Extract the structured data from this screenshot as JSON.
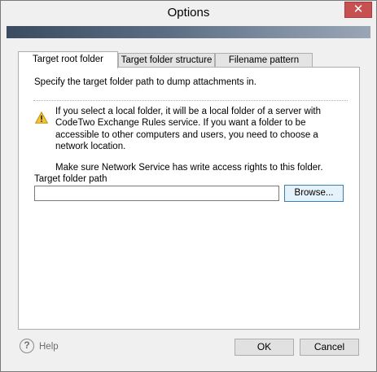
{
  "window": {
    "title": "Options",
    "close_glyph": "✕"
  },
  "tabs": [
    {
      "label": "Target root folder",
      "active": true
    },
    {
      "label": "Target folder structure",
      "active": false
    },
    {
      "label": "Filename pattern",
      "active": false
    }
  ],
  "panel": {
    "description": "Specify the target folder path to dump attachments in.",
    "warning_icon": "warning-triangle-icon",
    "warning_paragraph_1": "If you select a local folder, it will be a local folder of a server with CodeTwo Exchange Rules service. If you want a folder to be accessible to other computers and users, you need to choose a network location.",
    "warning_paragraph_2": "Make sure Network Service has write access rights to this folder.",
    "field_label": "Target folder path",
    "field_value": "",
    "browse_label": "Browse..."
  },
  "footer": {
    "help_glyph": "?",
    "help_label": "Help",
    "ok_label": "OK",
    "cancel_label": "Cancel"
  },
  "colors": {
    "close_button": "#c75050",
    "banner_dark": "#3b4b60",
    "browse_border": "#3c7fb1",
    "warning_yellow": "#f4c430"
  }
}
